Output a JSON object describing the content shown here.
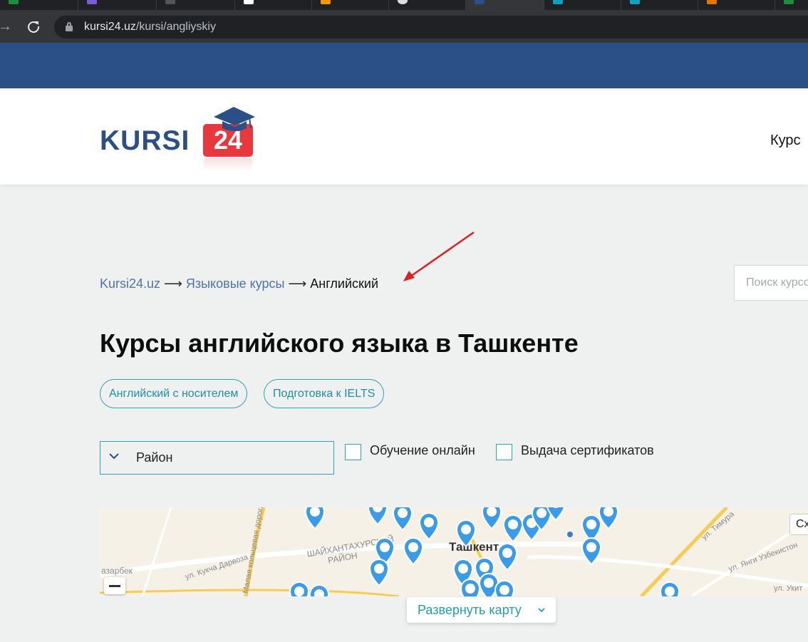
{
  "browser": {
    "url_host": "kursi24.uz",
    "url_path": "/kursi/angliyskiy"
  },
  "header": {
    "logo_text": "KURSI",
    "logo_number": "24",
    "nav_item": "Курс"
  },
  "breadcrumb": {
    "items": [
      "Kursi24.uz",
      "Языковые курсы",
      "Английский"
    ],
    "separator": "⟶"
  },
  "search": {
    "placeholder": "Поиск курсов"
  },
  "page_title": "Курсы английского языка в Ташкенте",
  "tags": [
    "Английский с носителем",
    "Подготовка к IELTS"
  ],
  "filters": {
    "district_label": "Район",
    "online_label": "Обучение онлайн",
    "certificate_label": "Выдача сертификатов"
  },
  "map": {
    "labels": {
      "district": "ШАЙХАНТАХУРСКИЙ",
      "district2": "РАЙОН",
      "city": "Ташкент",
      "street1": "ул. Кукча Дарвоза",
      "street2": "Малая кольцевая дорога",
      "street3": "азарбек",
      "street4": "ул. Тимура",
      "street5": "ул. Янги Узбекистон",
      "street6": "ул. Укит"
    },
    "right_button": "Сх",
    "expand_label": "Развернуть карту"
  },
  "colors": {
    "brand_blue": "#2b5088",
    "brand_red": "#e8383d",
    "accent_teal": "#2fa3b3",
    "pin": "#3a9be8"
  }
}
